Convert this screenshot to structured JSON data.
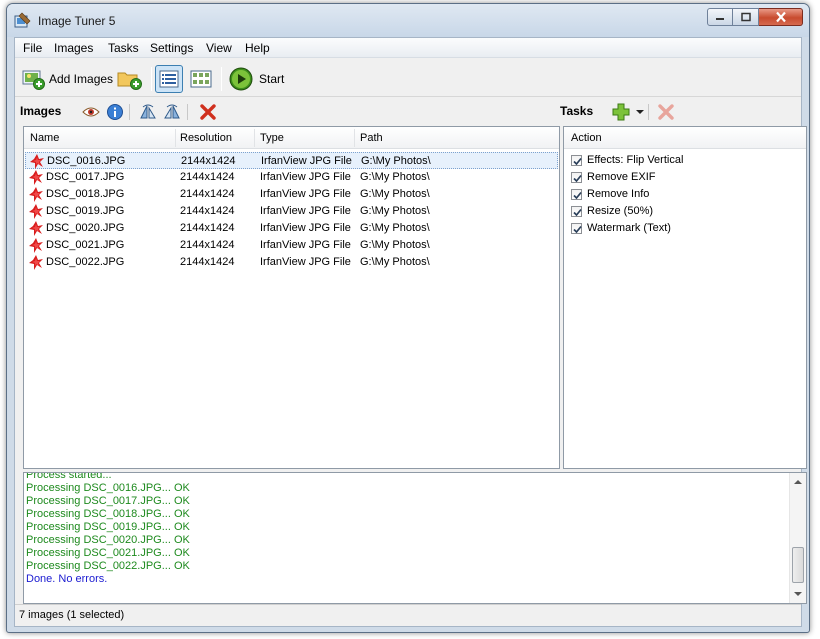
{
  "window": {
    "title": "Image Tuner 5"
  },
  "menu": [
    "File",
    "Images",
    "Tasks",
    "Settings",
    "View",
    "Help"
  ],
  "toolbar": {
    "add_images_label": "Add Images",
    "start_label": "Start"
  },
  "images_panel": {
    "title": "Images",
    "columns": [
      "Name",
      "Resolution",
      "Type",
      "Path"
    ],
    "rows": [
      {
        "name": "DSC_0016.JPG",
        "resolution": "2144x1424",
        "type": "IrfanView JPG File",
        "path": "G:\\My Photos\\",
        "selected": true
      },
      {
        "name": "DSC_0017.JPG",
        "resolution": "2144x1424",
        "type": "IrfanView JPG File",
        "path": "G:\\My Photos\\",
        "selected": false
      },
      {
        "name": "DSC_0018.JPG",
        "resolution": "2144x1424",
        "type": "IrfanView JPG File",
        "path": "G:\\My Photos\\",
        "selected": false
      },
      {
        "name": "DSC_0019.JPG",
        "resolution": "2144x1424",
        "type": "IrfanView JPG File",
        "path": "G:\\My Photos\\",
        "selected": false
      },
      {
        "name": "DSC_0020.JPG",
        "resolution": "2144x1424",
        "type": "IrfanView JPG File",
        "path": "G:\\My Photos\\",
        "selected": false
      },
      {
        "name": "DSC_0021.JPG",
        "resolution": "2144x1424",
        "type": "IrfanView JPG File",
        "path": "G:\\My Photos\\",
        "selected": false
      },
      {
        "name": "DSC_0022.JPG",
        "resolution": "2144x1424",
        "type": "IrfanView JPG File",
        "path": "G:\\My Photos\\",
        "selected": false
      }
    ]
  },
  "tasks_panel": {
    "title": "Tasks",
    "column": "Action",
    "items": [
      {
        "label": "Effects: Flip Vertical",
        "checked": true
      },
      {
        "label": "Remove EXIF",
        "checked": true
      },
      {
        "label": "Remove Info",
        "checked": true
      },
      {
        "label": "Resize (50%)",
        "checked": true
      },
      {
        "label": "Watermark (Text)",
        "checked": true
      }
    ]
  },
  "log": {
    "lines": [
      {
        "text": "Process started...",
        "color": "#1e8a1e"
      },
      {
        "text": "Processing DSC_0016.JPG... OK",
        "color": "#1e8a1e"
      },
      {
        "text": "Processing DSC_0017.JPG... OK",
        "color": "#1e8a1e"
      },
      {
        "text": "Processing DSC_0018.JPG... OK",
        "color": "#1e8a1e"
      },
      {
        "text": "Processing DSC_0019.JPG... OK",
        "color": "#1e8a1e"
      },
      {
        "text": "Processing DSC_0020.JPG... OK",
        "color": "#1e8a1e"
      },
      {
        "text": "Processing DSC_0021.JPG... OK",
        "color": "#1e8a1e"
      },
      {
        "text": "Processing DSC_0022.JPG... OK",
        "color": "#1e8a1e"
      },
      {
        "text": "Done. No errors.",
        "color": "#1b1bd1"
      }
    ]
  },
  "status": {
    "text": "7 images (1 selected)"
  },
  "icons": {
    "app": "image-tuner-icon",
    "add_images": "add-images-icon",
    "add_folder": "add-folder-icon",
    "details_view": "details-view-icon",
    "thumbnails_view": "thumbnails-view-icon",
    "start": "play-icon",
    "preview": "eye-icon",
    "info": "info-icon",
    "rotate_left": "rotate-left-icon",
    "rotate_right": "rotate-right-icon",
    "remove": "delete-icon",
    "add_task": "plus-icon",
    "remove_task": "delete-icon"
  }
}
